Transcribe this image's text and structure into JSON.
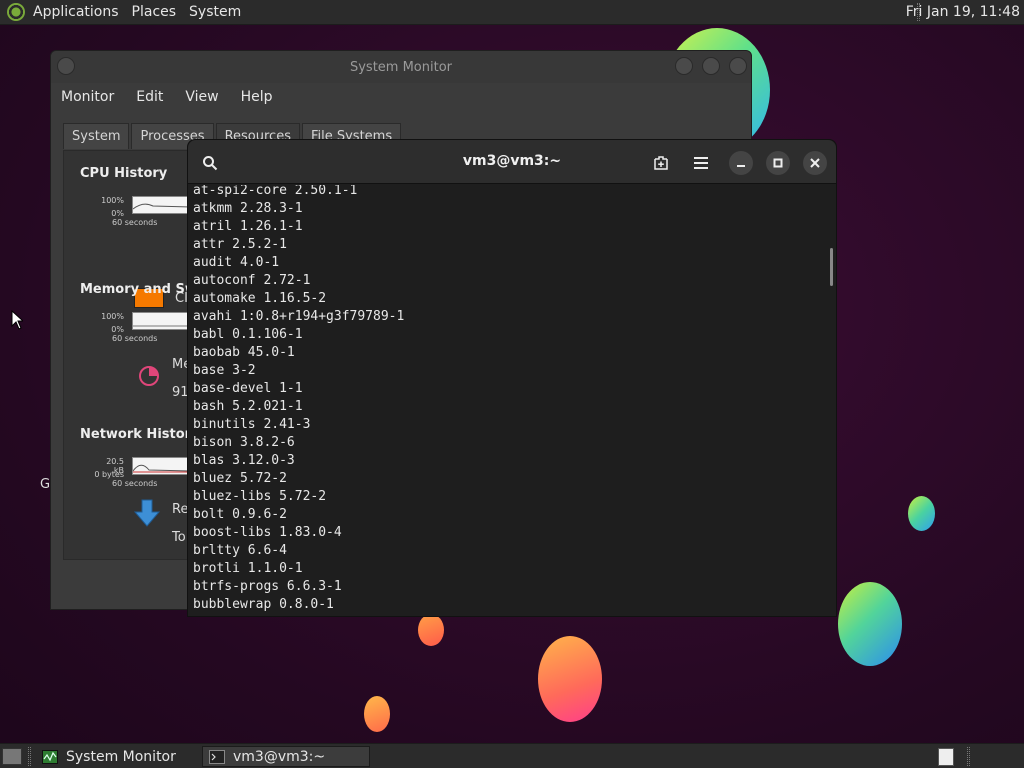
{
  "top_panel": {
    "menus": [
      "Applications",
      "Places",
      "System"
    ],
    "clock": "Fri Jan 19, 11:48"
  },
  "system_monitor": {
    "title": "System Monitor",
    "menus": [
      "Monitor",
      "Edit",
      "View",
      "Help"
    ],
    "tabs": [
      "System",
      "Processes",
      "Resources",
      "File Systems"
    ],
    "active_tab": "Resources",
    "cpu": {
      "title": "CPU History",
      "y_max": "100%",
      "y_min": "0%",
      "x_label": "60 seconds",
      "legend_cut": "CI",
      "swatch_color": "#f57900"
    },
    "memory": {
      "title": "Memory and Swa",
      "y_max": "100%",
      "y_min": "0%",
      "x_label": "60 seconds",
      "label_cut_1": "Me",
      "label_cut_2": "91"
    },
    "network": {
      "title": "Network History",
      "y_max": "20.5 kB",
      "y_min": "0 bytes",
      "x_label": "60 seconds",
      "label_cut_1": "Re",
      "label_cut_2": "To"
    }
  },
  "terminal": {
    "title": "vm3@vm3:~",
    "lines": [
      "at-spi2-core 2.50.1-1",
      "atkmm 2.28.3-1",
      "atril 1.26.1-1",
      "attr 2.5.2-1",
      "audit 4.0-1",
      "autoconf 2.72-1",
      "automake 1.16.5-2",
      "avahi 1:0.8+r194+g3f79789-1",
      "babl 0.1.106-1",
      "baobab 45.0-1",
      "base 3-2",
      "base-devel 1-1",
      "bash 5.2.021-1",
      "binutils 2.41-3",
      "bison 3.8.2-6",
      "blas 3.12.0-3",
      "bluez 5.72-2",
      "bluez-libs 5.72-2",
      "bolt 0.9.6-2",
      "boost-libs 1.83.0-4",
      "brltty 6.6-4",
      "brotli 1.1.0-1",
      "btrfs-progs 6.6.3-1",
      "bubblewrap 0.8.0-1"
    ]
  },
  "desktop": {
    "letter_cut": "G"
  },
  "taskbar": {
    "tasks": [
      {
        "label": "System Monitor",
        "active": false
      },
      {
        "label": "vm3@vm3:~",
        "active": true
      }
    ]
  },
  "icons": {
    "search": "search-icon",
    "new_tab": "new-tab-icon",
    "menu": "hamburger-menu-icon",
    "minimize": "minimize-icon",
    "maximize": "maximize-icon",
    "close": "close-icon"
  }
}
